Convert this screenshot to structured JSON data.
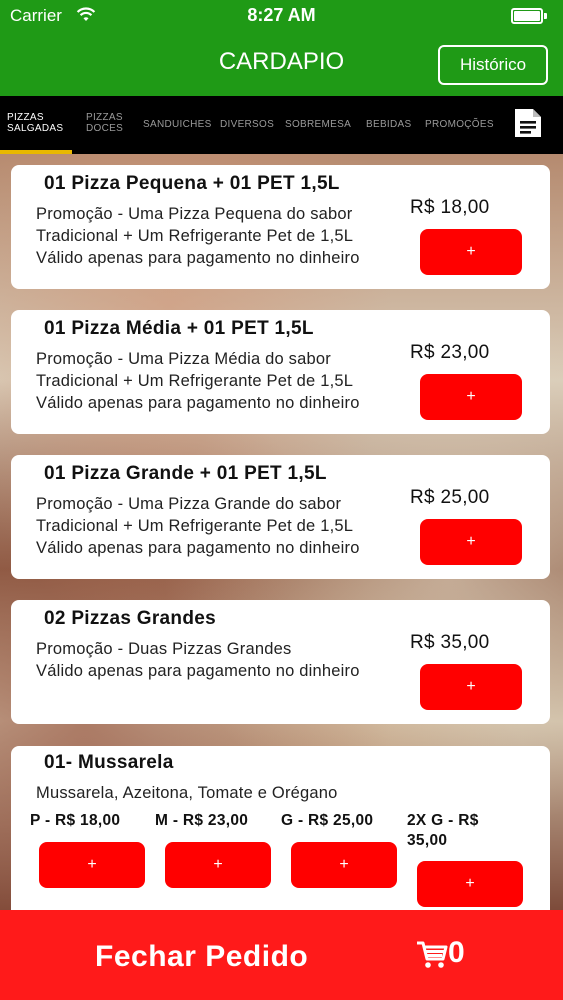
{
  "status_bar": {
    "carrier": "Carrier",
    "time": "8:27 AM"
  },
  "nav": {
    "title": "CARDAPIO",
    "history_button": "Histórico"
  },
  "tabs": [
    {
      "line1": "PIZZAS",
      "line2": "SALGADAS",
      "active": true
    },
    {
      "line1": "PIZZAS",
      "line2": "DOCES",
      "active": false
    },
    {
      "line1": "SANDUICHES",
      "line2": "",
      "active": false
    },
    {
      "line1": "DIVERSOS",
      "line2": "",
      "active": false
    },
    {
      "line1": "SOBREMESA",
      "line2": "",
      "active": false
    },
    {
      "line1": "BEBIDAS",
      "line2": "",
      "active": false
    },
    {
      "line1": "PROMOÇÕES",
      "line2": "",
      "active": false
    }
  ],
  "menu": [
    {
      "title": "01 Pizza Pequena + 01 PET 1,5L",
      "desc": [
        "Promoção - Uma Pizza Pequena do sabor",
        "Tradicional + Um Refrigerante Pet de 1,5L",
        "Válido apenas para pagamento no dinheiro"
      ],
      "price": "R$ 18,00",
      "add": "+"
    },
    {
      "title": "01 Pizza Média + 01 PET 1,5L",
      "desc": [
        "Promoção - Uma Pizza Média do sabor",
        "Tradicional + Um Refrigerante Pet de 1,5L",
        "Válido apenas para pagamento no dinheiro"
      ],
      "price": "R$ 23,00",
      "add": "+"
    },
    {
      "title": "01 Pizza Grande + 01 PET 1,5L",
      "desc": [
        "Promoção - Uma Pizza Grande do sabor",
        "Tradicional + Um Refrigerante Pet de 1,5L",
        "Válido apenas para pagamento no dinheiro"
      ],
      "price": "R$ 25,00",
      "add": "+"
    },
    {
      "title": "02 Pizzas Grandes",
      "desc": [
        "Promoção - Duas Pizzas Grandes",
        "Válido apenas para pagamento no dinheiro"
      ],
      "price": "R$ 35,00",
      "add": "+"
    }
  ],
  "flavor": {
    "title": "01- Mussarela",
    "desc": "Mussarela, Azeitona, Tomate e Orégano",
    "sizes": [
      {
        "label": "P - R$ 18,00",
        "add": "+"
      },
      {
        "label": "M - R$ 23,00",
        "add": "+"
      },
      {
        "label": "G - R$ 25,00",
        "add": "+"
      },
      {
        "label_line1": "2X G - R$",
        "label_line2": "35,00",
        "add": "+"
      }
    ]
  },
  "bottom_bar": {
    "checkout_label": "Fechar Pedido",
    "cart_count": "0"
  },
  "colors": {
    "header_green": "#1f9a16",
    "accent_red": "#ff0000",
    "bottom_red": "#ff1a1a",
    "tab_indicator": "#e8b800"
  },
  "icons": [
    "wifi-icon",
    "battery-icon",
    "document-icon",
    "cart-icon"
  ]
}
